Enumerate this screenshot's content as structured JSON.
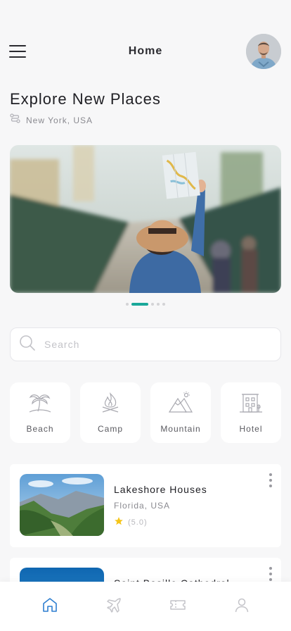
{
  "header": {
    "title": "Home",
    "menu_icon": "hamburger-menu-icon",
    "avatar_icon": "user-avatar"
  },
  "explore": {
    "title": "Explore New Places",
    "location": "New York, USA",
    "location_icon": "route-icon"
  },
  "carousel": {
    "slides": 5,
    "active_index": 1,
    "accent": "#1aa89a"
  },
  "search": {
    "placeholder": "Search",
    "value": "",
    "icon": "search-icon"
  },
  "categories": [
    {
      "label": "Beach",
      "icon": "beach-palm-icon"
    },
    {
      "label": "Camp",
      "icon": "campfire-icon"
    },
    {
      "label": "Mountain",
      "icon": "mountain-icon"
    },
    {
      "label": "Hotel",
      "icon": "hotel-icon"
    }
  ],
  "places": [
    {
      "title": "Lakeshore Houses",
      "location": "Florida, USA",
      "rating": "(5.0)",
      "star_color": "#f5c518"
    },
    {
      "title": "Saint Basille Cathedral",
      "location": "",
      "rating": ""
    }
  ],
  "tabbar": {
    "items": [
      {
        "name": "home",
        "icon": "home-icon",
        "active": true
      },
      {
        "name": "flights",
        "icon": "airplane-icon",
        "active": false
      },
      {
        "name": "tickets",
        "icon": "ticket-icon",
        "active": false
      },
      {
        "name": "profile",
        "icon": "user-icon",
        "active": false
      }
    ],
    "active_color": "#2f7fd0",
    "inactive_color": "#c4c4c9"
  }
}
